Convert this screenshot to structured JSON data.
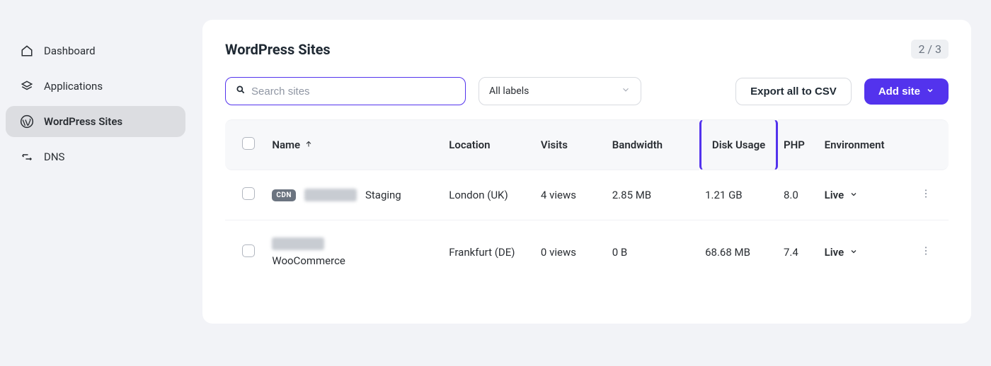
{
  "sidebar": {
    "items": [
      {
        "key": "dashboard",
        "label": "Dashboard"
      },
      {
        "key": "applications",
        "label": "Applications"
      },
      {
        "key": "wordpress-sites",
        "label": "WordPress Sites"
      },
      {
        "key": "dns",
        "label": "DNS"
      }
    ]
  },
  "header": {
    "title": "WordPress Sites",
    "pagination": "2 / 3"
  },
  "toolbar": {
    "search_placeholder": "Search sites",
    "labels_label": "All labels",
    "export_label": "Export all to CSV",
    "add_site_label": "Add site"
  },
  "columns": {
    "name": "Name",
    "location": "Location",
    "visits": "Visits",
    "bandwidth": "Bandwidth",
    "disk_usage": "Disk Usage",
    "php": "PHP",
    "environment": "Environment"
  },
  "rows": [
    {
      "cdn_badge": "CDN",
      "name_suffix": "Staging",
      "show_blur": true,
      "location": "London (UK)",
      "visits": "4 views",
      "bandwidth": "2.85 MB",
      "disk_usage": "1.21 GB",
      "php": "8.0",
      "environment": "Live"
    },
    {
      "cdn_badge": "",
      "name_suffix": "WooCommerce",
      "show_blur": true,
      "location": "Frankfurt (DE)",
      "visits": "0 views",
      "bandwidth": "0 B",
      "disk_usage": "68.68 MB",
      "php": "7.4",
      "environment": "Live"
    }
  ]
}
